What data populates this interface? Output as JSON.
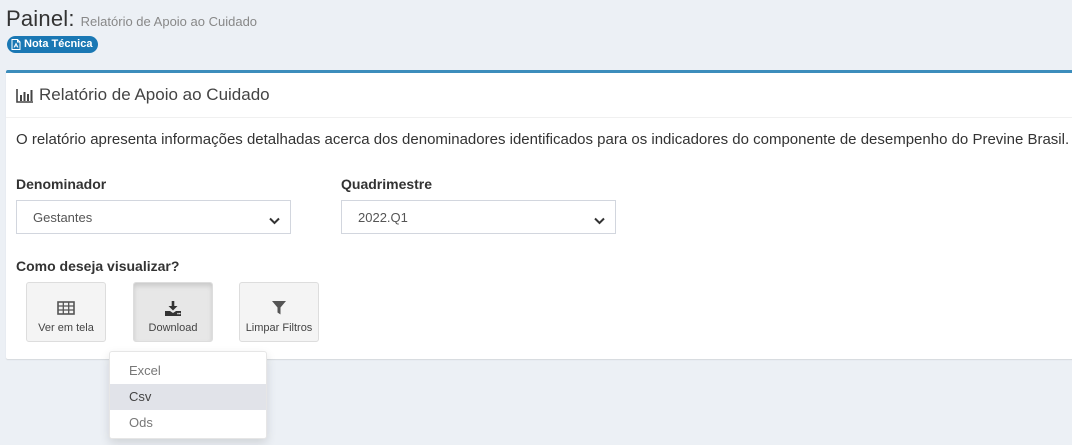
{
  "header": {
    "title": "Painel:",
    "subtitle": "Relatório de Apoio ao Cuidado",
    "badge_label": "Nota Técnica",
    "badge_icon": "pdf-file-icon"
  },
  "colors": {
    "accent": "#3c8dbc",
    "badge": "#1a78b4",
    "background": "#ecf0f5"
  },
  "panel": {
    "title": "Relatório de Apoio ao Cuidado",
    "title_icon": "bar-chart-icon",
    "description": "O relatório apresenta informações detalhadas acerca dos denominadores identificados para os indicadores do componente de desempenho do Previne Brasil."
  },
  "filters": {
    "denominador": {
      "label": "Denominador",
      "value": "Gestantes"
    },
    "quadrimestre": {
      "label": "Quadrimestre",
      "value": "2022.Q1"
    }
  },
  "visualize": {
    "label": "Como deseja visualizar?",
    "buttons": [
      {
        "label": "Ver em tela",
        "icon": "table-icon"
      },
      {
        "label": "Download",
        "icon": "download-icon"
      },
      {
        "label": "Limpar Filtros",
        "icon": "filter-icon"
      }
    ]
  },
  "download_menu": {
    "items": [
      "Excel",
      "Csv",
      "Ods"
    ],
    "highlighted": "Csv"
  }
}
